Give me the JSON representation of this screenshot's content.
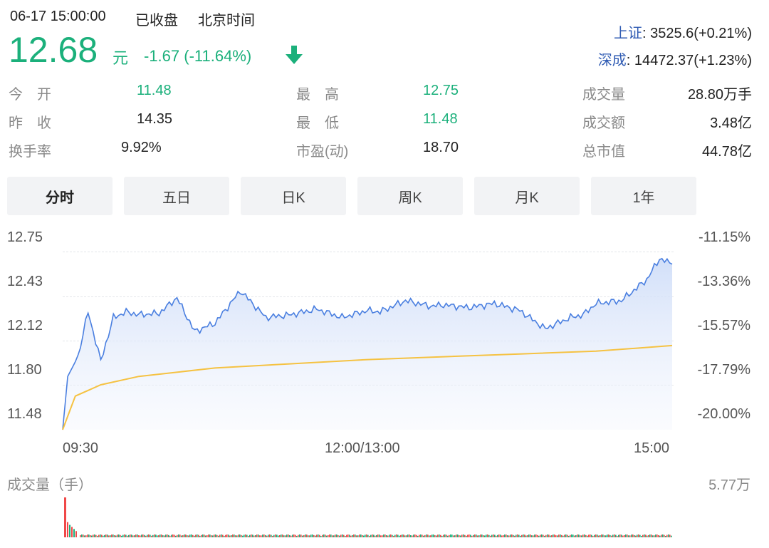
{
  "header": {
    "datetime": "06-17 15:00:00",
    "status": "已收盘",
    "timezone": "北京时间",
    "price": "12.68",
    "unit": "元",
    "change": "-1.67 (-11.64%)",
    "direction_icon": "arrow-down-icon"
  },
  "indices": [
    {
      "name": "上证",
      "value": ": 3525.6(+0.21%)"
    },
    {
      "name": "深成",
      "value": ": 14472.37(+1.23%)"
    }
  ],
  "stats": [
    {
      "label": "今　开",
      "value": "11.48"
    },
    {
      "label": "最　高",
      "value": "12.75"
    },
    {
      "label": "成交量",
      "value": "28.80万手"
    },
    {
      "label": "昨　收",
      "value": "14.35"
    },
    {
      "label": "最　低",
      "value": "11.48"
    },
    {
      "label": "成交额",
      "value": "3.48亿"
    },
    {
      "label": "换手率",
      "value": "9.92%"
    },
    {
      "label": "市盈(动)",
      "value": "18.70"
    },
    {
      "label": "总市值",
      "value": "44.78亿"
    }
  ],
  "tabs": [
    "分时",
    "五日",
    "日K",
    "周K",
    "月K",
    "1年"
  ],
  "active_tab": "分时",
  "colors": {
    "up": "#f04848",
    "down": "#1bb07b",
    "price_line": "#4a7fe0",
    "avg_line": "#f5c242",
    "link": "#2f5bb3"
  },
  "chart_data": {
    "type": "line",
    "x_ticks": [
      "09:30",
      "12:00/13:00",
      "15:00"
    ],
    "y_ticks_left": [
      "12.75",
      "12.43",
      "12.12",
      "11.80",
      "11.48"
    ],
    "y_ticks_right": [
      "-11.15%",
      "-13.36%",
      "-15.57%",
      "-17.79%",
      "-20.00%"
    ],
    "ylim": [
      11.48,
      12.75
    ],
    "series": [
      {
        "key": "price",
        "x": [
          0,
          2,
          6,
          10,
          15,
          20,
          25,
          30,
          38,
          45,
          52,
          60,
          70,
          80,
          90,
          100,
          110,
          120,
          125,
          135,
          145,
          150,
          160,
          170,
          180,
          190,
          200,
          205,
          210,
          220,
          230,
          235,
          240
        ],
        "values": [
          11.48,
          11.86,
          12.0,
          12.32,
          11.97,
          12.28,
          12.32,
          12.3,
          12.31,
          12.42,
          12.18,
          12.24,
          12.47,
          12.28,
          12.3,
          12.34,
          12.28,
          12.33,
          12.32,
          12.4,
          12.36,
          12.37,
          12.35,
          12.38,
          12.33,
          12.2,
          12.28,
          12.3,
          12.38,
          12.4,
          12.55,
          12.7,
          12.66
        ]
      },
      {
        "key": "avg",
        "x": [
          0,
          5,
          15,
          30,
          60,
          90,
          120,
          150,
          180,
          210,
          240
        ],
        "values": [
          11.48,
          11.72,
          11.8,
          11.86,
          11.92,
          11.95,
          11.98,
          12.0,
          12.02,
          12.04,
          12.08
        ]
      }
    ],
    "volume_label": "成交量（手）",
    "volume_max_label": "5.77万",
    "volume_max": 57700,
    "volume_first": 57700,
    "volume_next": [
      22000,
      18000,
      15000,
      12000,
      9000
    ]
  }
}
